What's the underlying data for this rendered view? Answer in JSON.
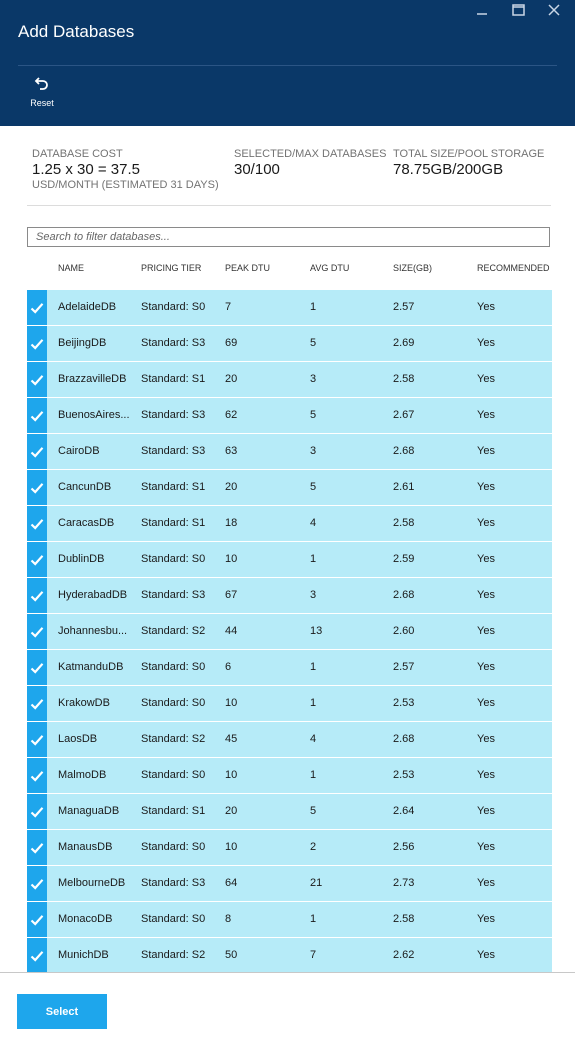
{
  "header": {
    "title": "Add Databases",
    "reset_label": "Reset"
  },
  "summary": {
    "cost_label": "DATABASE COST",
    "cost_value": "1.25 x 30 = 37.5",
    "cost_unit": "USD/MONTH (ESTIMATED 31 DAYS)",
    "selected_label": "SELECTED/MAX DATABASES",
    "selected_value": "30/100",
    "storage_label": "TOTAL SIZE/POOL STORAGE",
    "storage_value": "78.75GB/200GB"
  },
  "search": {
    "placeholder": "Search to filter databases..."
  },
  "table": {
    "headers": {
      "name": "NAME",
      "tier": "PRICING TIER",
      "peak": "PEAK DTU",
      "avg": "AVG DTU",
      "size": "SIZE(GB)",
      "recommended": "RECOMMENDED"
    },
    "rows": [
      {
        "name": "AdelaideDB",
        "tier": "Standard: S0",
        "peak": "7",
        "avg": "1",
        "size": "2.57",
        "rec": "Yes"
      },
      {
        "name": "BeijingDB",
        "tier": "Standard: S3",
        "peak": "69",
        "avg": "5",
        "size": "2.69",
        "rec": "Yes"
      },
      {
        "name": "BrazzavilleDB",
        "tier": "Standard: S1",
        "peak": "20",
        "avg": "3",
        "size": "2.58",
        "rec": "Yes"
      },
      {
        "name": "BuenosAires...",
        "tier": "Standard: S3",
        "peak": "62",
        "avg": "5",
        "size": "2.67",
        "rec": "Yes"
      },
      {
        "name": "CairoDB",
        "tier": "Standard: S3",
        "peak": "63",
        "avg": "3",
        "size": "2.68",
        "rec": "Yes"
      },
      {
        "name": "CancunDB",
        "tier": "Standard: S1",
        "peak": "20",
        "avg": "5",
        "size": "2.61",
        "rec": "Yes"
      },
      {
        "name": "CaracasDB",
        "tier": "Standard: S1",
        "peak": "18",
        "avg": "4",
        "size": "2.58",
        "rec": "Yes"
      },
      {
        "name": "DublinDB",
        "tier": "Standard: S0",
        "peak": "10",
        "avg": "1",
        "size": "2.59",
        "rec": "Yes"
      },
      {
        "name": "HyderabadDB",
        "tier": "Standard: S3",
        "peak": "67",
        "avg": "3",
        "size": "2.68",
        "rec": "Yes"
      },
      {
        "name": "Johannesbu...",
        "tier": "Standard: S2",
        "peak": "44",
        "avg": "13",
        "size": "2.60",
        "rec": "Yes"
      },
      {
        "name": "KatmanduDB",
        "tier": "Standard: S0",
        "peak": "6",
        "avg": "1",
        "size": "2.57",
        "rec": "Yes"
      },
      {
        "name": "KrakowDB",
        "tier": "Standard: S0",
        "peak": "10",
        "avg": "1",
        "size": "2.53",
        "rec": "Yes"
      },
      {
        "name": "LaosDB",
        "tier": "Standard: S2",
        "peak": "45",
        "avg": "4",
        "size": "2.68",
        "rec": "Yes"
      },
      {
        "name": "MalmoDB",
        "tier": "Standard: S0",
        "peak": "10",
        "avg": "1",
        "size": "2.53",
        "rec": "Yes"
      },
      {
        "name": "ManaguaDB",
        "tier": "Standard: S1",
        "peak": "20",
        "avg": "5",
        "size": "2.64",
        "rec": "Yes"
      },
      {
        "name": "ManausDB",
        "tier": "Standard: S0",
        "peak": "10",
        "avg": "2",
        "size": "2.56",
        "rec": "Yes"
      },
      {
        "name": "MelbourneDB",
        "tier": "Standard: S3",
        "peak": "64",
        "avg": "21",
        "size": "2.73",
        "rec": "Yes"
      },
      {
        "name": "MonacoDB",
        "tier": "Standard: S0",
        "peak": "8",
        "avg": "1",
        "size": "2.58",
        "rec": "Yes"
      },
      {
        "name": "MunichDB",
        "tier": "Standard: S2",
        "peak": "50",
        "avg": "7",
        "size": "2.62",
        "rec": "Yes"
      }
    ]
  },
  "footer": {
    "select_label": "Select"
  },
  "colors": {
    "header_bg": "#0a3868",
    "row_bg": "#b6ebf8",
    "accent": "#1ea6ec"
  }
}
